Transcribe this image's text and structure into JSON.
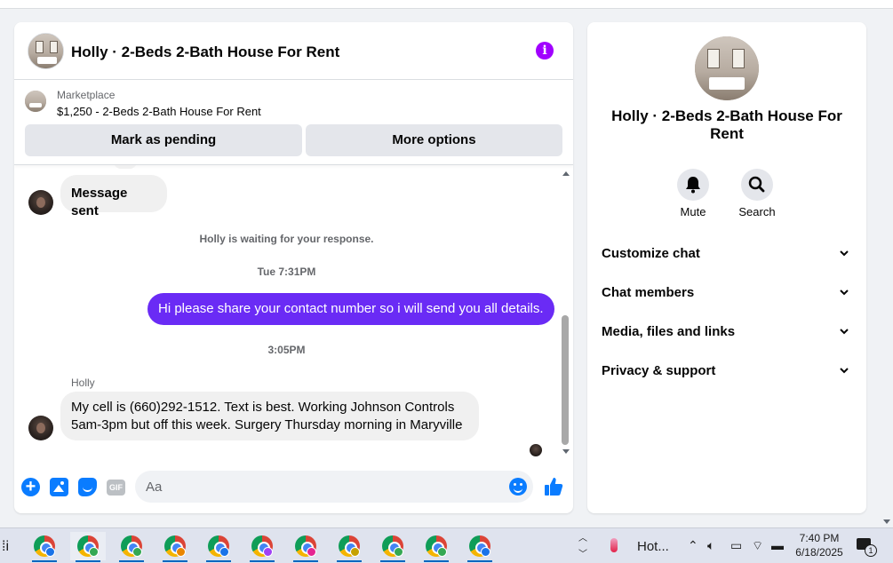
{
  "chat": {
    "title": "Holly · 2-Beds 2-Bath House For Rent",
    "listing": {
      "kind": "Marketplace",
      "description": "$1,250 - 2-Beds 2-Bath House For Rent"
    },
    "actions": {
      "mark_pending": "Mark as pending",
      "more_options": "More options"
    },
    "messages": [
      {
        "from": "Holly",
        "direction": "incoming",
        "text": "Message sent"
      },
      {
        "type": "system",
        "text": "Holly is waiting for your response."
      },
      {
        "type": "timestamp",
        "text": "Tue 7:31PM"
      },
      {
        "from": "me",
        "direction": "outgoing",
        "text": "Hi please share your contact number so i will send you all details."
      },
      {
        "type": "timestamp",
        "text": "3:05PM"
      },
      {
        "from": "Holly",
        "direction": "incoming",
        "sender_label": "Holly",
        "lines": [
          "My cell is (660)292-1512. Text is best. Working Johnson Controls",
          "5am-3pm but off this week. Surgery Thursday morning in Maryville"
        ]
      }
    ],
    "composer": {
      "placeholder": "Aa",
      "gif_label": "GIF"
    },
    "colors": {
      "accent": "#0a7cff",
      "outgoing_bubble": "#6a2bf5",
      "info_icon": "#a100ff"
    }
  },
  "info_panel": {
    "title": "Holly · 2-Beds 2-Bath House For Rent",
    "buttons": [
      {
        "icon": "bell-icon",
        "label": "Mute"
      },
      {
        "icon": "search-icon",
        "label": "Search"
      }
    ],
    "sections": [
      {
        "label": "Customize chat"
      },
      {
        "label": "Chat members"
      },
      {
        "label": "Media, files and links"
      },
      {
        "label": "Privacy & support"
      }
    ]
  },
  "taskbar": {
    "weather": "Hot...",
    "time": "7:40 PM",
    "date": "6/18/2025",
    "notification_count": "1",
    "apps": [
      {
        "icon": "chrome-icon",
        "profile_color": "#1a73e8"
      },
      {
        "icon": "chrome-icon",
        "profile_color": "#34a853",
        "active": true
      },
      {
        "icon": "chrome-icon",
        "profile_color": "#34a853"
      },
      {
        "icon": "chrome-icon",
        "profile_color": "#ea8600"
      },
      {
        "icon": "chrome-icon",
        "profile_color": "#1a73e8"
      },
      {
        "icon": "chrome-icon",
        "profile_color": "#a142f4"
      },
      {
        "icon": "chrome-icon",
        "profile_color": "#e52592"
      },
      {
        "icon": "chrome-icon",
        "profile_color": "#c5a100"
      },
      {
        "icon": "chrome-icon",
        "profile_color": "#34a853"
      },
      {
        "icon": "chrome-icon",
        "profile_color": "#34a853"
      },
      {
        "icon": "chrome-icon",
        "profile_color": "#1a73e8"
      }
    ]
  }
}
